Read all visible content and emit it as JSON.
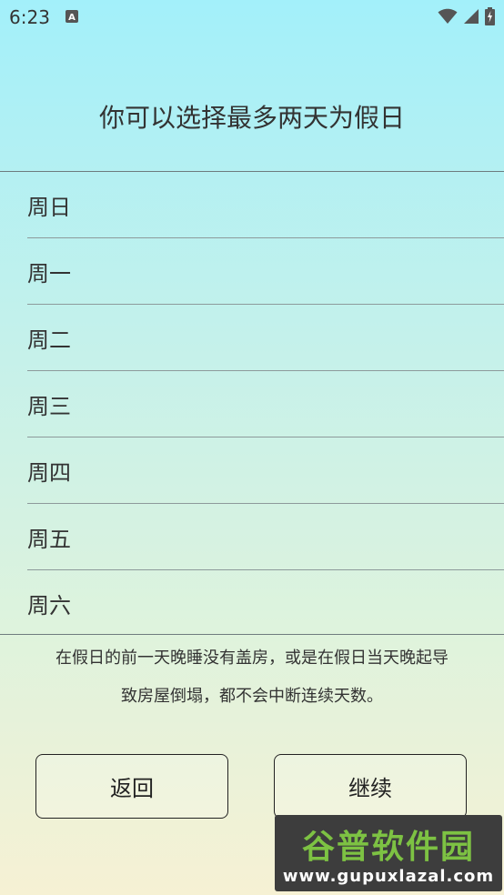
{
  "status_bar": {
    "time": "6:23",
    "app_icon_letter": "A",
    "icons": [
      "wifi-icon",
      "signal-icon",
      "battery-icon"
    ]
  },
  "title": "你可以选择最多两天为假日",
  "days": [
    {
      "label": "周日"
    },
    {
      "label": "周一"
    },
    {
      "label": "周二"
    },
    {
      "label": "周三"
    },
    {
      "label": "周四"
    },
    {
      "label": "周五"
    },
    {
      "label": "周六"
    }
  ],
  "note": {
    "line1": "在假日的前一天晚睡没有盖房，或是在假日当天晚起导",
    "line2": "致房屋倒塌，都不会中断连续天数。"
  },
  "buttons": {
    "back_label": "返回",
    "continue_label": "继续"
  },
  "watermark": {
    "chinese": "谷普软件园",
    "url": "www.gupuxlazal.com"
  },
  "colors": {
    "gradient_top": "#a3f0fa",
    "gradient_bottom": "#f6f1d4",
    "watermark_green": "#7dc243",
    "watermark_bg": "#3d3d3d"
  }
}
